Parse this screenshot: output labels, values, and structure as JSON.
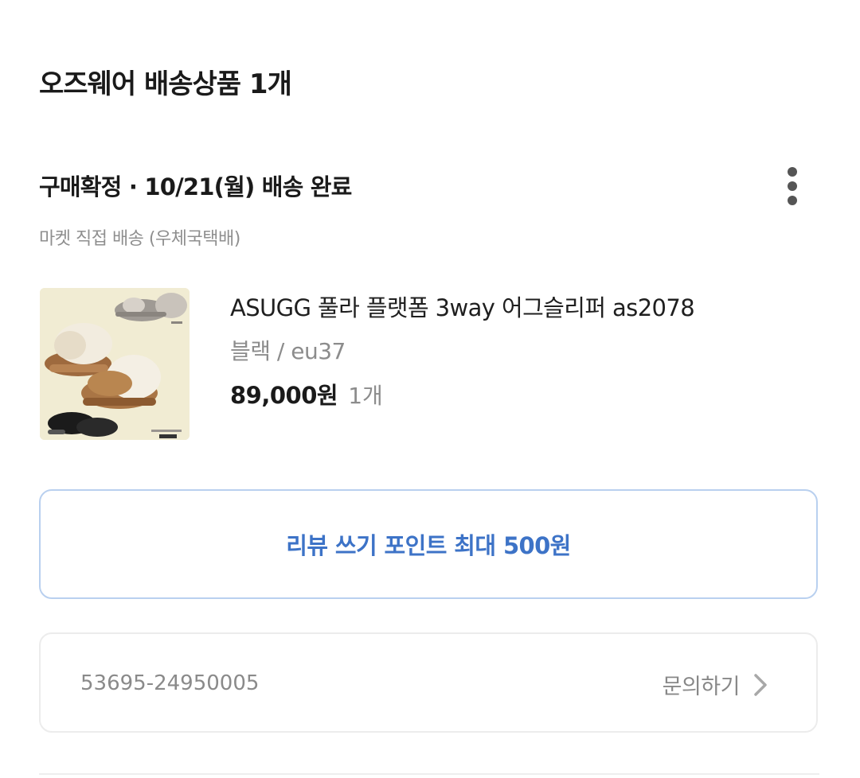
{
  "section": {
    "title": "오즈웨어 배송상품 1개"
  },
  "order": {
    "status": "구매확정 · 10/21(월) 배송 완료",
    "delivery_method": "마켓 직접 배송 (우체국택배)",
    "more_icon": "more-vertical-icon"
  },
  "product": {
    "name": "ASUGG 풀라 플랫폼 3way 어그슬리퍼 as2078",
    "option": "블랙 / eu37",
    "price": "89,000원",
    "quantity": "1개"
  },
  "review": {
    "label": "리뷰 쓰기 포인트 최대 500원",
    "accent_color": "#3d73c7"
  },
  "order_info": {
    "number": "53695-24950005",
    "inquiry_label": "문의하기",
    "inquiry_icon": "chevron-right-icon"
  }
}
